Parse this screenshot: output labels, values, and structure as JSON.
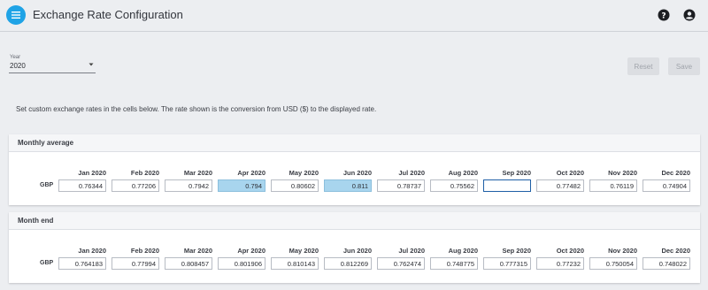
{
  "header": {
    "title": "Exchange Rate Configuration"
  },
  "year": {
    "label": "Year",
    "value": "2020"
  },
  "actions": {
    "reset_label": "Reset",
    "save_label": "Save"
  },
  "intro": "Set custom exchange rates in the cells below. The rate shown is the conversion from USD ($) to the displayed rate.",
  "months": [
    "Jan 2020",
    "Feb 2020",
    "Mar 2020",
    "Apr 2020",
    "May 2020",
    "Jun 2020",
    "Jul 2020",
    "Aug 2020",
    "Sep 2020",
    "Oct 2020",
    "Nov 2020",
    "Dec 2020"
  ],
  "monthly_average": {
    "title": "Monthly average",
    "currency": "GBP",
    "values": [
      "0.76344",
      "0.77206",
      "0.7942",
      "0.794",
      "0.80602",
      "0.811",
      "0.78737",
      "0.75562",
      "",
      "0.77482",
      "0.76119",
      "0.74904"
    ]
  },
  "month_end": {
    "title": "Month end",
    "currency": "GBP",
    "values": [
      "0.764183",
      "0.77994",
      "0.808457",
      "0.801906",
      "0.810143",
      "0.812269",
      "0.762474",
      "0.748775",
      "0.777315",
      "0.77232",
      "0.750054",
      "0.748022"
    ]
  },
  "colors": {
    "accent": "#1fa3e6",
    "highlight": "#a8d5ee",
    "focus": "#1f5fa6"
  }
}
